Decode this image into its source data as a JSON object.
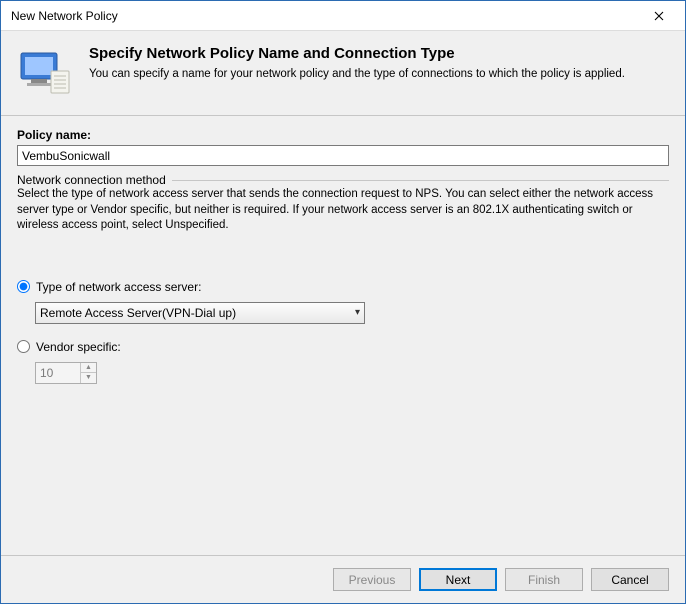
{
  "window": {
    "title": "New Network Policy"
  },
  "header": {
    "title": "Specify Network Policy Name and Connection Type",
    "description": "You can specify a name for your network policy and the type of connections to which the policy is applied."
  },
  "policy": {
    "label": "Policy name:",
    "value": "VembuSonicwall"
  },
  "group": {
    "title": "Network connection method",
    "help": "Select the type of network access server that sends the connection request to NPS. You can select either the network access server type or Vendor specific, but neither is required.  If your network access server is an 802.1X authenticating switch or wireless access point, select Unspecified."
  },
  "options": {
    "type_radio_label": "Type of network access server:",
    "type_selected": "Remote Access Server(VPN-Dial up)",
    "vendor_radio_label": "Vendor specific:",
    "vendor_value": "10"
  },
  "buttons": {
    "previous": "Previous",
    "next": "Next",
    "finish": "Finish",
    "cancel": "Cancel"
  }
}
